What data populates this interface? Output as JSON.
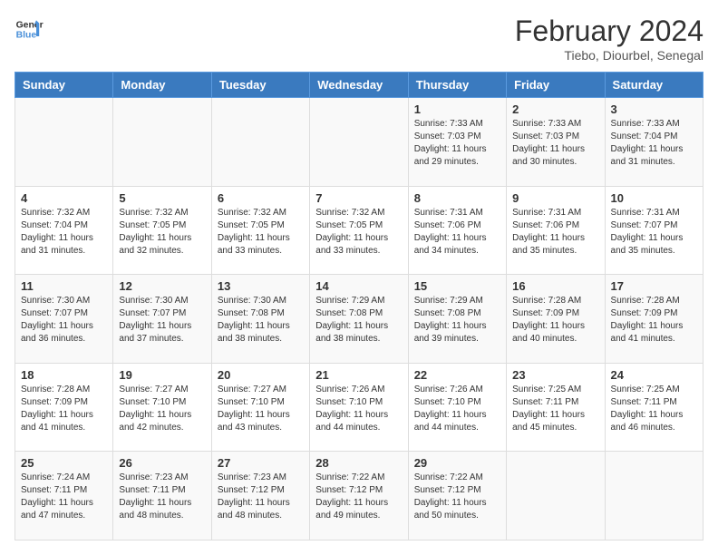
{
  "header": {
    "logo_line1": "General",
    "logo_line2": "Blue",
    "month_year": "February 2024",
    "location": "Tiebo, Diourbel, Senegal"
  },
  "days_of_week": [
    "Sunday",
    "Monday",
    "Tuesday",
    "Wednesday",
    "Thursday",
    "Friday",
    "Saturday"
  ],
  "weeks": [
    [
      {
        "day": "",
        "info": ""
      },
      {
        "day": "",
        "info": ""
      },
      {
        "day": "",
        "info": ""
      },
      {
        "day": "",
        "info": ""
      },
      {
        "day": "1",
        "info": "Sunrise: 7:33 AM\nSunset: 7:03 PM\nDaylight: 11 hours and 29 minutes."
      },
      {
        "day": "2",
        "info": "Sunrise: 7:33 AM\nSunset: 7:03 PM\nDaylight: 11 hours and 30 minutes."
      },
      {
        "day": "3",
        "info": "Sunrise: 7:33 AM\nSunset: 7:04 PM\nDaylight: 11 hours and 31 minutes."
      }
    ],
    [
      {
        "day": "4",
        "info": "Sunrise: 7:32 AM\nSunset: 7:04 PM\nDaylight: 11 hours and 31 minutes."
      },
      {
        "day": "5",
        "info": "Sunrise: 7:32 AM\nSunset: 7:05 PM\nDaylight: 11 hours and 32 minutes."
      },
      {
        "day": "6",
        "info": "Sunrise: 7:32 AM\nSunset: 7:05 PM\nDaylight: 11 hours and 33 minutes."
      },
      {
        "day": "7",
        "info": "Sunrise: 7:32 AM\nSunset: 7:05 PM\nDaylight: 11 hours and 33 minutes."
      },
      {
        "day": "8",
        "info": "Sunrise: 7:31 AM\nSunset: 7:06 PM\nDaylight: 11 hours and 34 minutes."
      },
      {
        "day": "9",
        "info": "Sunrise: 7:31 AM\nSunset: 7:06 PM\nDaylight: 11 hours and 35 minutes."
      },
      {
        "day": "10",
        "info": "Sunrise: 7:31 AM\nSunset: 7:07 PM\nDaylight: 11 hours and 35 minutes."
      }
    ],
    [
      {
        "day": "11",
        "info": "Sunrise: 7:30 AM\nSunset: 7:07 PM\nDaylight: 11 hours and 36 minutes."
      },
      {
        "day": "12",
        "info": "Sunrise: 7:30 AM\nSunset: 7:07 PM\nDaylight: 11 hours and 37 minutes."
      },
      {
        "day": "13",
        "info": "Sunrise: 7:30 AM\nSunset: 7:08 PM\nDaylight: 11 hours and 38 minutes."
      },
      {
        "day": "14",
        "info": "Sunrise: 7:29 AM\nSunset: 7:08 PM\nDaylight: 11 hours and 38 minutes."
      },
      {
        "day": "15",
        "info": "Sunrise: 7:29 AM\nSunset: 7:08 PM\nDaylight: 11 hours and 39 minutes."
      },
      {
        "day": "16",
        "info": "Sunrise: 7:28 AM\nSunset: 7:09 PM\nDaylight: 11 hours and 40 minutes."
      },
      {
        "day": "17",
        "info": "Sunrise: 7:28 AM\nSunset: 7:09 PM\nDaylight: 11 hours and 41 minutes."
      }
    ],
    [
      {
        "day": "18",
        "info": "Sunrise: 7:28 AM\nSunset: 7:09 PM\nDaylight: 11 hours and 41 minutes."
      },
      {
        "day": "19",
        "info": "Sunrise: 7:27 AM\nSunset: 7:10 PM\nDaylight: 11 hours and 42 minutes."
      },
      {
        "day": "20",
        "info": "Sunrise: 7:27 AM\nSunset: 7:10 PM\nDaylight: 11 hours and 43 minutes."
      },
      {
        "day": "21",
        "info": "Sunrise: 7:26 AM\nSunset: 7:10 PM\nDaylight: 11 hours and 44 minutes."
      },
      {
        "day": "22",
        "info": "Sunrise: 7:26 AM\nSunset: 7:10 PM\nDaylight: 11 hours and 44 minutes."
      },
      {
        "day": "23",
        "info": "Sunrise: 7:25 AM\nSunset: 7:11 PM\nDaylight: 11 hours and 45 minutes."
      },
      {
        "day": "24",
        "info": "Sunrise: 7:25 AM\nSunset: 7:11 PM\nDaylight: 11 hours and 46 minutes."
      }
    ],
    [
      {
        "day": "25",
        "info": "Sunrise: 7:24 AM\nSunset: 7:11 PM\nDaylight: 11 hours and 47 minutes."
      },
      {
        "day": "26",
        "info": "Sunrise: 7:23 AM\nSunset: 7:11 PM\nDaylight: 11 hours and 48 minutes."
      },
      {
        "day": "27",
        "info": "Sunrise: 7:23 AM\nSunset: 7:12 PM\nDaylight: 11 hours and 48 minutes."
      },
      {
        "day": "28",
        "info": "Sunrise: 7:22 AM\nSunset: 7:12 PM\nDaylight: 11 hours and 49 minutes."
      },
      {
        "day": "29",
        "info": "Sunrise: 7:22 AM\nSunset: 7:12 PM\nDaylight: 11 hours and 50 minutes."
      },
      {
        "day": "",
        "info": ""
      },
      {
        "day": "",
        "info": ""
      }
    ]
  ]
}
